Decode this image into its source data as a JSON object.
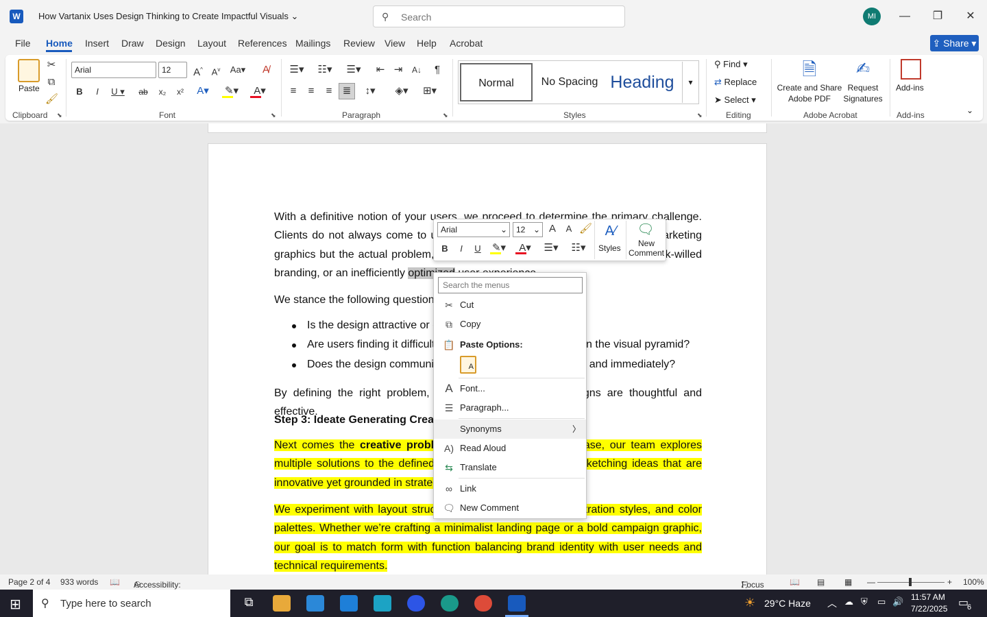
{
  "titlebar": {
    "doc_title": "How Vartanix Uses Design Thinking to Create Impactful Visuals",
    "search_placeholder": "Search",
    "avatar_initials": "MI"
  },
  "tabs": [
    "File",
    "Home",
    "Insert",
    "Draw",
    "Design",
    "Layout",
    "References",
    "Mailings",
    "Review",
    "View",
    "Help",
    "Acrobat"
  ],
  "share_label": "Share",
  "ribbon": {
    "paste_label": "Paste",
    "font_name": "Arial",
    "font_size": "12",
    "styles": [
      "Normal",
      "No Spacing",
      "Heading"
    ],
    "find_label": "Find",
    "replace_label": "Replace",
    "select_label": "Select",
    "create_share_pdf": "Create and Share Adobe PDF",
    "request_signatures": "Request Signatures",
    "addins_label": "Add-ins",
    "groups": {
      "clipboard": "Clipboard",
      "font": "Font",
      "paragraph": "Paragraph",
      "styles": "Styles",
      "editing": "Editing",
      "adobe": "Adobe Acrobat",
      "addins": "Add-ins"
    }
  },
  "document": {
    "p1_start": "With a definitive notion of your users, we proceed to determine the primary challenge. Clients do not always come to us with a clear problem. It might be not the marketing graphics but the actual problem, which could be poorly visible messaging, weak-willed branding, or an inefficiently ",
    "p1_selected": "optimized",
    "p1_end": " user experience.",
    "p2": "We stance the following questions:",
    "bullets": [
      "Is the design attractive or does it just look nice?",
      "Are users finding it difficult to understand the information in the visual pyramid?",
      "Does the design communicate the brand message clearly and immediately?"
    ],
    "p3": "By defining the right problem, we make sure that our designs are thoughtful and effective.",
    "step3_heading": "Step 3: Ideate Generating Creative Solutions",
    "p4_start": "Next comes the ",
    "p4_bold": "creative problem-solving",
    "p4_end": " phase. In this phase, our team explores multiple solutions to the defined problem, brainstorming and sketching ideas that are innovative yet grounded in strategy.",
    "p5": "We experiment with layout structures, typography, colors, illustration styles, and color palettes. Whether we’re crafting a minimalist landing page or a bold campaign graphic, our goal is to match form with function balancing brand identity with user needs and technical requirements."
  },
  "mini_toolbar": {
    "font_name": "Arial",
    "font_size": "12",
    "styles_label": "Styles",
    "new_comment_label": "New Comment"
  },
  "context_menu": {
    "search_placeholder": "Search the menus",
    "cut": "Cut",
    "copy": "Copy",
    "paste_options": "Paste Options:",
    "font": "Font...",
    "paragraph": "Paragraph...",
    "synonyms": "Synonyms",
    "read_aloud": "Read Aloud",
    "translate": "Translate",
    "link": "Link",
    "new_comment": "New Comment"
  },
  "statusbar": {
    "page": "Page 2 of 4",
    "words": "933 words",
    "accessibility": "Accessibility: Good to go",
    "focus": "Focus",
    "zoom": "100%"
  },
  "taskbar": {
    "search_placeholder": "Type here to search",
    "weather": "29°C  Haze",
    "time": "11:57 AM",
    "date": "7/22/2025",
    "notification_count": "6"
  }
}
